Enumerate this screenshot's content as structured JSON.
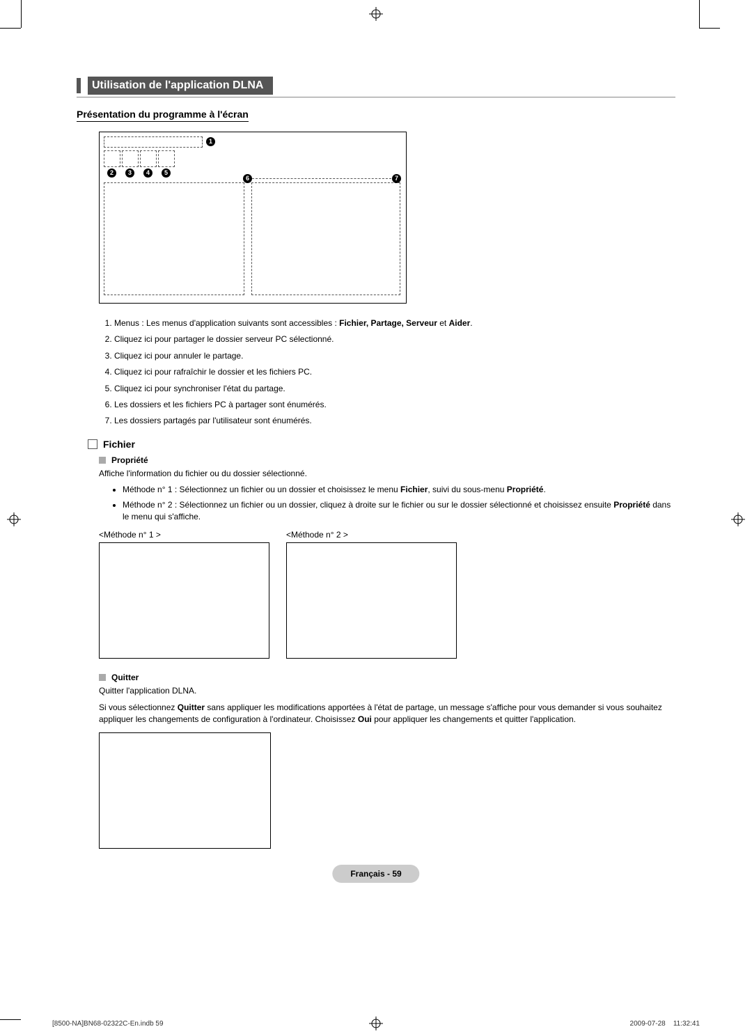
{
  "section_title": "Utilisation de l'application DLNA",
  "sub_heading": "Présentation du programme à l'écran",
  "callouts": [
    "1",
    "2",
    "3",
    "4",
    "5",
    "6",
    "7"
  ],
  "numlist": [
    {
      "pre": "Menus : Les menus d'application suivants sont accessibles : ",
      "bold": "Fichier, Partage, Serveur",
      "mid": " et ",
      "bold2": "Aider",
      "post": "."
    },
    {
      "text": "Cliquez ici pour partager le dossier serveur PC sélectionné."
    },
    {
      "text": "Cliquez ici pour annuler le partage."
    },
    {
      "text": "Cliquez ici pour rafraîchir le dossier et les fichiers PC."
    },
    {
      "text": "Cliquez ici pour synchroniser l'état du partage."
    },
    {
      "text": "Les dossiers et les fichiers PC à partager sont énumérés."
    },
    {
      "text": "Les dossiers partagés par l'utilisateur sont énumérés."
    }
  ],
  "fichier": {
    "heading": "Fichier",
    "propriete": {
      "label": "Propriété",
      "intro": "Affiche l'information du fichier ou du dossier sélectionné.",
      "m1_pre": "Méthode n° 1 : Sélectionnez un fichier ou un dossier et choisissez le menu ",
      "m1_b1": "Fichier",
      "m1_mid": ", suivi du sous-menu ",
      "m1_b2": "Propriété",
      "m1_post": ".",
      "m2_pre": "Méthode n° 2 : Sélectionnez un fichier ou un dossier, cliquez à droite sur le fichier ou sur le dossier sélectionné et choisissez ensuite ",
      "m2_b": "Propriété",
      "m2_post": " dans le menu qui s'affiche.",
      "method1_label": "<Méthode n° 1 >",
      "method2_label": "<Méthode n° 2 >"
    },
    "quitter": {
      "label": "Quitter",
      "line1": "Quitter l'application DLNA.",
      "line2_pre": "Si vous sélectionnez ",
      "line2_b1": "Quitter",
      "line2_mid": " sans appliquer les modifications apportées à l'état de partage, un message s'affiche pour vous demander si vous souhaitez appliquer les changements de configuration à l'ordinateur. Choisissez ",
      "line2_b2": "Oui",
      "line2_post": " pour appliquer les changements et quitter l'application."
    }
  },
  "footer_pill": "Français - 59",
  "print_footer_left": "[8500-NA]BN68-02322C-En.indb   59",
  "print_footer_right": "2009-07-28      11:32:41"
}
